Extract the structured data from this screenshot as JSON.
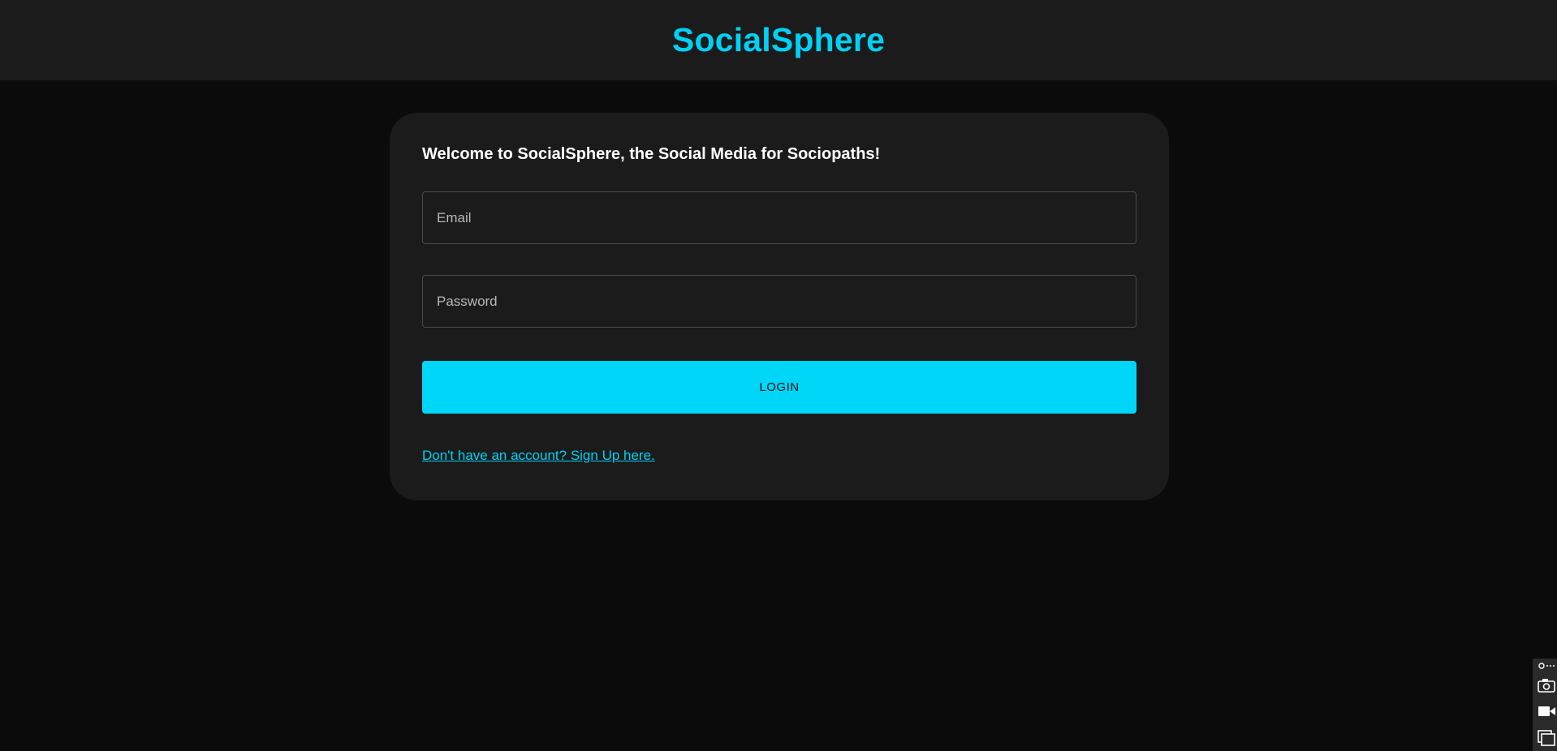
{
  "header": {
    "brand": "SocialSphere"
  },
  "login_card": {
    "welcome": "Welcome to SocialSphere, the Social Media for Sociopaths!",
    "email_placeholder": "Email",
    "email_value": "",
    "password_placeholder": "Password",
    "password_value": "",
    "login_label": "LOGIN",
    "signup_link": "Don't have an account? Sign Up here."
  },
  "side_tools": {
    "icons": [
      "link-icon",
      "more-icon",
      "camera-icon",
      "video-icon",
      "window-icon"
    ]
  },
  "colors": {
    "accent": "#00d6f8",
    "page_bg": "#0b0b0b",
    "panel_bg": "#1b1b1b"
  }
}
